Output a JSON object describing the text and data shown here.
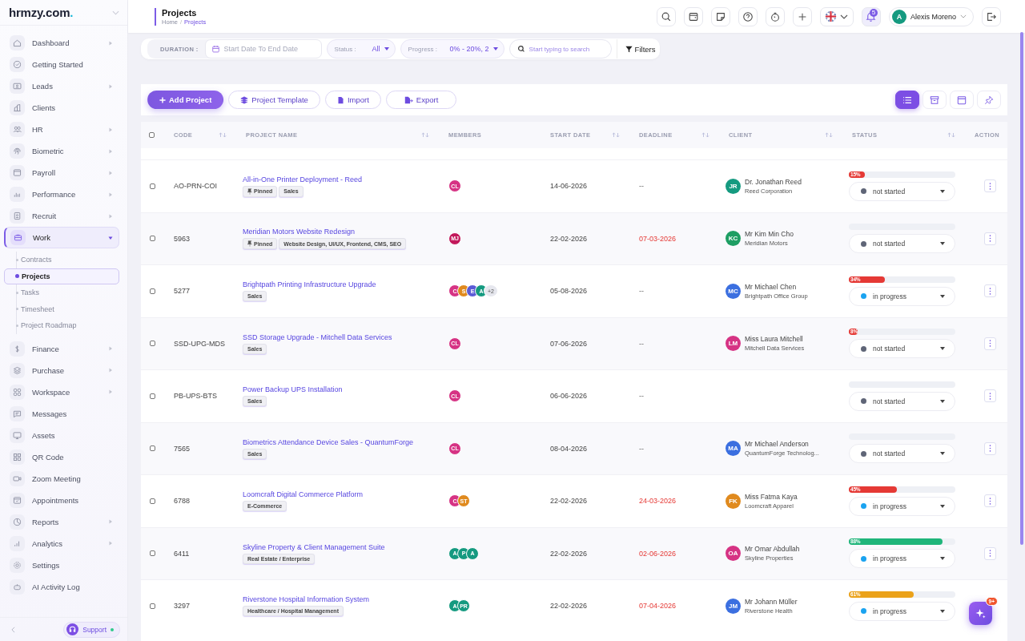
{
  "sidebar": {
    "logo": "hrmzy.com.",
    "items": [
      {
        "label": "Dashboard",
        "expandable": true,
        "selected": false
      },
      {
        "label": "Getting Started",
        "expandable": false,
        "selected": false
      },
      {
        "label": "Leads",
        "expandable": true,
        "selected": false
      },
      {
        "label": "Clients",
        "expandable": false,
        "selected": false
      },
      {
        "label": "HR",
        "expandable": true,
        "selected": false
      },
      {
        "label": "Biometric",
        "expandable": true,
        "selected": false
      },
      {
        "label": "Payroll",
        "expandable": true,
        "selected": false
      },
      {
        "label": "Performance",
        "expandable": true,
        "selected": false
      },
      {
        "label": "Recruit",
        "expandable": true,
        "selected": false
      },
      {
        "label": "Work",
        "expandable": true,
        "selected": true,
        "expanded": true,
        "children": [
          {
            "label": "Contracts",
            "selected": false
          },
          {
            "label": "Projects",
            "selected": true
          },
          {
            "label": "Tasks",
            "selected": false
          },
          {
            "label": "Timesheet",
            "selected": false
          },
          {
            "label": "Project Roadmap",
            "selected": false
          }
        ]
      },
      {
        "label": "Finance",
        "expandable": true,
        "selected": false
      },
      {
        "label": "Purchase",
        "expandable": true,
        "selected": false
      },
      {
        "label": "Workspace",
        "expandable": true,
        "selected": false
      },
      {
        "label": "Messages",
        "expandable": false,
        "selected": false
      },
      {
        "label": "Assets",
        "expandable": false,
        "selected": false
      },
      {
        "label": "QR Code",
        "expandable": false,
        "selected": false
      },
      {
        "label": "Zoom Meeting",
        "expandable": false,
        "selected": false
      },
      {
        "label": "Appointments",
        "expandable": false,
        "selected": false
      },
      {
        "label": "Reports",
        "expandable": true,
        "selected": false
      },
      {
        "label": "Analytics",
        "expandable": true,
        "selected": false
      },
      {
        "label": "Settings",
        "expandable": false,
        "selected": false
      },
      {
        "label": "AI Activity Log",
        "expandable": false,
        "selected": false
      }
    ],
    "support": "Support"
  },
  "header": {
    "title": "Projects",
    "breadcrumb": [
      "Home",
      "Projects"
    ],
    "breadcrumb_separator": "/",
    "notification_count": "5",
    "user": {
      "initial": "A",
      "name": "Alexis Moreno"
    }
  },
  "filters": {
    "duration_label": "DURATION :",
    "date_placeholder": "Start Date To End Date",
    "status_label": "Status :",
    "status_value": "All",
    "progress_label": "Progress :",
    "progress_value": "0% - 20%, 2",
    "search_placeholder": "Start typing to search",
    "filters_button": "Filters"
  },
  "toolbar": {
    "buttons": [
      "Add Project",
      "Project Template",
      "Import",
      "Export"
    ],
    "views": [
      {
        "selected": true
      },
      {
        "selected": false
      },
      {
        "selected": false
      },
      {
        "selected": false
      }
    ]
  },
  "table": {
    "select_all": false,
    "columns": [
      {
        "label": "CODE",
        "sortable": true
      },
      {
        "label": "PROJECT NAME",
        "sortable": true
      },
      {
        "label": "MEMBERS",
        "sortable": false
      },
      {
        "label": "START DATE",
        "sortable": true
      },
      {
        "label": "DEADLINE",
        "sortable": true
      },
      {
        "label": "CLIENT",
        "sortable": true
      },
      {
        "label": "STATUS",
        "sortable": true
      },
      {
        "label": "ACTION",
        "sortable": false
      }
    ],
    "rows": [
      {
        "checked": false,
        "code": "AO-PRN-COI",
        "name": "All-in-One Printer Deployment - Reed",
        "tags": [
          {
            "kind": "pinned",
            "label": "Pinned"
          },
          {
            "kind": "tag",
            "label": "Sales"
          }
        ],
        "members": [
          {
            "initials": "CL",
            "color": "#d63384"
          }
        ],
        "start": "14-06-2026",
        "deadline": "--",
        "overdue": false,
        "client": {
          "initials": "JR",
          "color": "#159a80",
          "name": "Dr. Jonathan Reed",
          "company": "Reed Corporation"
        },
        "progress": {
          "level": 0.15,
          "label": "15%",
          "color": "#e53935"
        },
        "status": {
          "label": "not started",
          "color": "#5f6577"
        },
        "menu": true
      },
      {
        "checked": false,
        "code": "5963",
        "name": "Meridian Motors Website Redesign",
        "tags": [
          {
            "kind": "pinned",
            "label": "Pinned"
          },
          {
            "kind": "tag",
            "label": "Website Design, UI/UX, Frontend, CMS, SEO"
          }
        ],
        "members": [
          {
            "initials": "MJ",
            "color": "#c2185b"
          }
        ],
        "start": "22-02-2026",
        "deadline": "07-03-2026",
        "overdue": true,
        "client": {
          "initials": "KC",
          "color": "#1e9e63",
          "name": "Mr Kim Min Cho",
          "company": "Meridian Motors"
        },
        "progress": {
          "level": 0
        },
        "status": {
          "label": "not started",
          "color": "#5f6577"
        },
        "menu": true
      },
      {
        "checked": false,
        "code": "5277",
        "name": "Brightpath Printing Infrastructure Upgrade",
        "tags": [
          {
            "kind": "tag",
            "label": "Sales"
          }
        ],
        "members": [
          {
            "initials": "C",
            "color": "#d63384"
          },
          {
            "initials": "S",
            "color": "#e08a1e"
          },
          {
            "initials": "E",
            "color": "#5b5bd6"
          },
          {
            "initials": "A",
            "color": "#159a80"
          },
          {
            "initials": "+2",
            "color": "#e6e7ee"
          }
        ],
        "start": "05-08-2026",
        "deadline": "--",
        "overdue": false,
        "client": {
          "initials": "MC",
          "color": "#3b6fe0",
          "name": "Mr Michael Chen",
          "company": "Brightpath Office Group"
        },
        "progress": {
          "level": 0.34,
          "label": "34%",
          "color": "#e53935"
        },
        "status": {
          "label": "in progress",
          "color": "#1aa3f0"
        },
        "menu": true
      },
      {
        "checked": false,
        "code": "SSD-UPG-MDS",
        "name": "SSD Storage Upgrade - Mitchell Data Services",
        "tags": [
          {
            "kind": "tag",
            "label": "Sales"
          }
        ],
        "members": [
          {
            "initials": "CL",
            "color": "#d63384"
          }
        ],
        "start": "07-06-2026",
        "deadline": "--",
        "overdue": false,
        "client": {
          "initials": "LM",
          "color": "#d63384",
          "name": "Miss Laura Mitchell",
          "company": "Mitchell Data Services"
        },
        "progress": {
          "level": 0.08,
          "label": "8%",
          "color": "#e53935"
        },
        "status": {
          "label": "not started",
          "color": "#5f6577"
        },
        "menu": true
      },
      {
        "checked": false,
        "code": "PB-UPS-BTS",
        "name": "Power Backup UPS Installation",
        "tags": [
          {
            "kind": "tag",
            "label": "Sales"
          }
        ],
        "members": [
          {
            "initials": "CL",
            "color": "#d63384"
          }
        ],
        "start": "06-06-2026",
        "deadline": "--",
        "overdue": false,
        "progress": {
          "level": 0
        },
        "status": {
          "label": "not started",
          "color": "#5f6577"
        },
        "menu": true
      },
      {
        "checked": false,
        "code": "7565",
        "name": "Biometrics Attendance Device Sales - QuantumForge",
        "tags": [
          {
            "kind": "tag",
            "label": "Sales"
          }
        ],
        "members": [
          {
            "initials": "CL",
            "color": "#d63384"
          }
        ],
        "start": "08-04-2026",
        "deadline": "--",
        "overdue": false,
        "client": {
          "initials": "MA",
          "color": "#3b6fe0",
          "name": "Mr Michael Anderson",
          "company": "QuantumForge Technolog..."
        },
        "progress": {
          "level": 0
        },
        "status": {
          "label": "not started",
          "color": "#5f6577"
        },
        "menu": true
      },
      {
        "checked": false,
        "code": "6788",
        "name": "Loomcraft Digital Commerce Platform",
        "tags": [
          {
            "kind": "tag",
            "label": "E-Commerce"
          }
        ],
        "members": [
          {
            "initials": "C",
            "color": "#d63384"
          },
          {
            "initials": "ST",
            "color": "#e08a1e"
          }
        ],
        "start": "22-02-2026",
        "deadline": "24-03-2026",
        "overdue": true,
        "client": {
          "initials": "FK",
          "color": "#e08a1e",
          "name": "Miss Fatma Kaya",
          "company": "Loomcraft Apparel"
        },
        "progress": {
          "level": 0.45,
          "label": "45%",
          "color": "#e53935"
        },
        "status": {
          "label": "in progress",
          "color": "#1aa3f0"
        },
        "menu": true
      },
      {
        "checked": false,
        "code": "6411",
        "name": "Skyline Property & Client Management Suite",
        "tags": [
          {
            "kind": "tag",
            "label": "Real Estate / Enterprise"
          }
        ],
        "members": [
          {
            "initials": "A",
            "color": "#159a80"
          },
          {
            "initials": "P",
            "color": "#159a80"
          },
          {
            "initials": "A",
            "color": "#159a80"
          }
        ],
        "start": "22-02-2026",
        "deadline": "02-06-2026",
        "overdue": true,
        "client": {
          "initials": "OA",
          "color": "#d63384",
          "name": "Mr Omar Abdullah",
          "company": "Skyline Properties"
        },
        "progress": {
          "level": 0.88,
          "label": "88%",
          "color": "#1fb57a"
        },
        "status": {
          "label": "in progress",
          "color": "#1aa3f0"
        },
        "menu": true
      },
      {
        "checked": false,
        "code": "3297",
        "name": "Riverstone Hospital Information System",
        "tags": [
          {
            "kind": "tag",
            "label": "Healthcare / Hospital Management"
          }
        ],
        "members": [
          {
            "initials": "A",
            "color": "#159a80"
          },
          {
            "initials": "PR",
            "color": "#159a80"
          }
        ],
        "start": "22-02-2026",
        "deadline": "07-04-2026",
        "overdue": true,
        "client": {
          "initials": "JM",
          "color": "#3b6fe0",
          "name": "Mr Johann Müller",
          "company": "Riverstone Health"
        },
        "progress": {
          "level": 0.61,
          "label": "61%",
          "color": "#eba21a"
        },
        "status": {
          "label": "in progress",
          "color": "#1aa3f0"
        },
        "menu": false
      }
    ]
  },
  "assistant": {
    "badge": "9+"
  }
}
